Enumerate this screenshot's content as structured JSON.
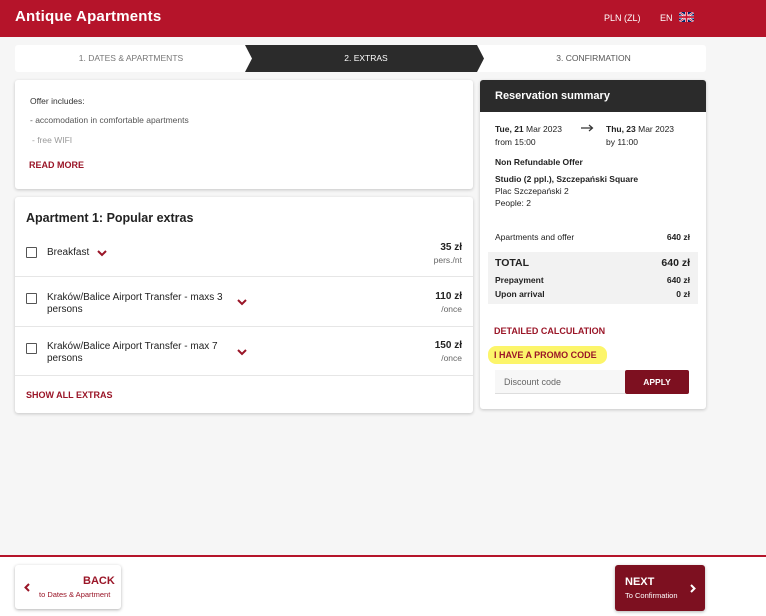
{
  "header": {
    "brand": "Antique Apartments",
    "currency": "PLN (ZL)",
    "language": "EN",
    "flag_icon": "uk-flag-icon"
  },
  "steps": {
    "step1": "1. DATES & APARTMENTS",
    "step2": "2. EXTRAS",
    "step3": "3. CONFIRMATION",
    "active": 2
  },
  "offer": {
    "heading": "Offer includes:",
    "line1": "- accomodation in comfortable apartments",
    "line2": "- free WIFI",
    "read_more": "READ MORE"
  },
  "extras": {
    "title": "Apartment 1: Popular extras",
    "items": [
      {
        "name": "Breakfast",
        "price": "35 zł",
        "unit": "pers./nt"
      },
      {
        "name": "Kraków/Balice Airport Transfer - maxs 3 persons",
        "price": "110 zł",
        "unit": "/once"
      },
      {
        "name": "Kraków/Balice Airport Transfer - max 7 persons",
        "price": "150 zł",
        "unit": "/once"
      }
    ],
    "show_all": "SHOW ALL EXTRAS"
  },
  "summary": {
    "title": "Reservation summary",
    "checkin_day": "Tue, 21",
    "checkin_month": " Mar 2023",
    "checkin_time": "from 15:00",
    "checkout_day": "Thu, 23",
    "checkout_month": " Mar 2023",
    "checkout_time": "by 11:00",
    "offer_name": "Non Refundable Offer",
    "apartment": "Studio (2 ppl.), Szczepański Square",
    "address": "Plac Szczepański 2",
    "people": "People: 2",
    "apartments_label": "Apartments and offer",
    "apartments_value": "640 zł",
    "total_label": "TOTAL",
    "total_value": "640 zł",
    "prepayment_label": "Prepayment",
    "prepayment_value": "640 zł",
    "arrival_label": "Upon arrival",
    "arrival_value": "0 zł",
    "detailed": "DETAILED CALCULATION",
    "promo": "I HAVE A PROMO CODE",
    "discount_placeholder": "Discount code",
    "apply": "APPLY"
  },
  "footer": {
    "back_label": "BACK",
    "back_sub": "to Dates & Apartment",
    "next_label": "NEXT",
    "next_sub": "To Confirmation"
  },
  "colors": {
    "brand_red": "#b5142a",
    "dark_red": "#7d1020",
    "dark_step": "#2b2b2b",
    "highlight": "#fcf45a"
  }
}
